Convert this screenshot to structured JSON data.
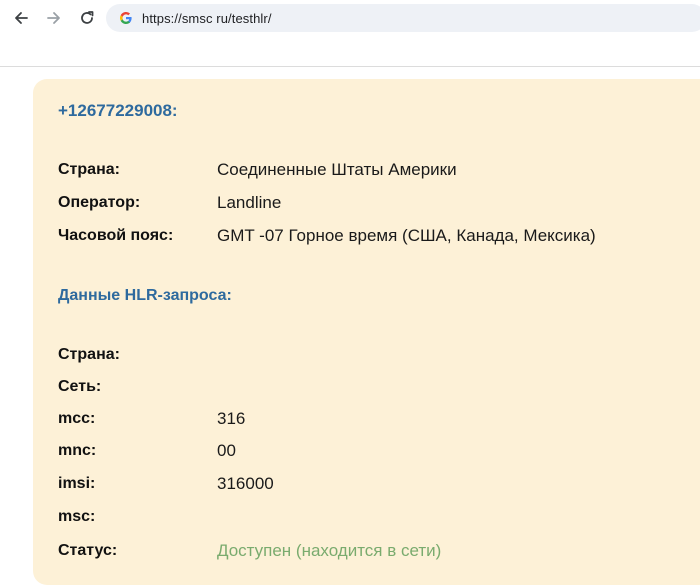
{
  "browser": {
    "url": "https://smsc ru/testhlr/",
    "back_icon": "back-arrow-icon",
    "forward_icon": "forward-arrow-icon",
    "reload_icon": "reload-icon",
    "site_icon": "google-g-icon"
  },
  "result": {
    "phone": "+12677229008:",
    "info": [
      {
        "label": "Страна:",
        "value": "Соединенные Штаты Америки"
      },
      {
        "label": "Оператор:",
        "value": "Landline"
      },
      {
        "label": "Часовой пояс:",
        "value": "GMT -07 Горное время (США, Канада, Мексика)"
      }
    ],
    "hlr_title": "Данные HLR-запроса:",
    "hlr": [
      {
        "label": "Страна:",
        "value": ""
      },
      {
        "label": "Сеть:",
        "value": ""
      },
      {
        "label": "mcc:",
        "value": "316"
      },
      {
        "label": "mnc:",
        "value": "00"
      },
      {
        "label": "imsi:",
        "value": "316000"
      },
      {
        "label": "msc:",
        "value": ""
      }
    ],
    "status": {
      "label": "Статус:",
      "value": "Доступен (находится в сети)"
    }
  },
  "colors": {
    "card_bg": "#fdf1d7",
    "link_blue": "#2e6a9e",
    "status_green": "#7aab6e"
  }
}
